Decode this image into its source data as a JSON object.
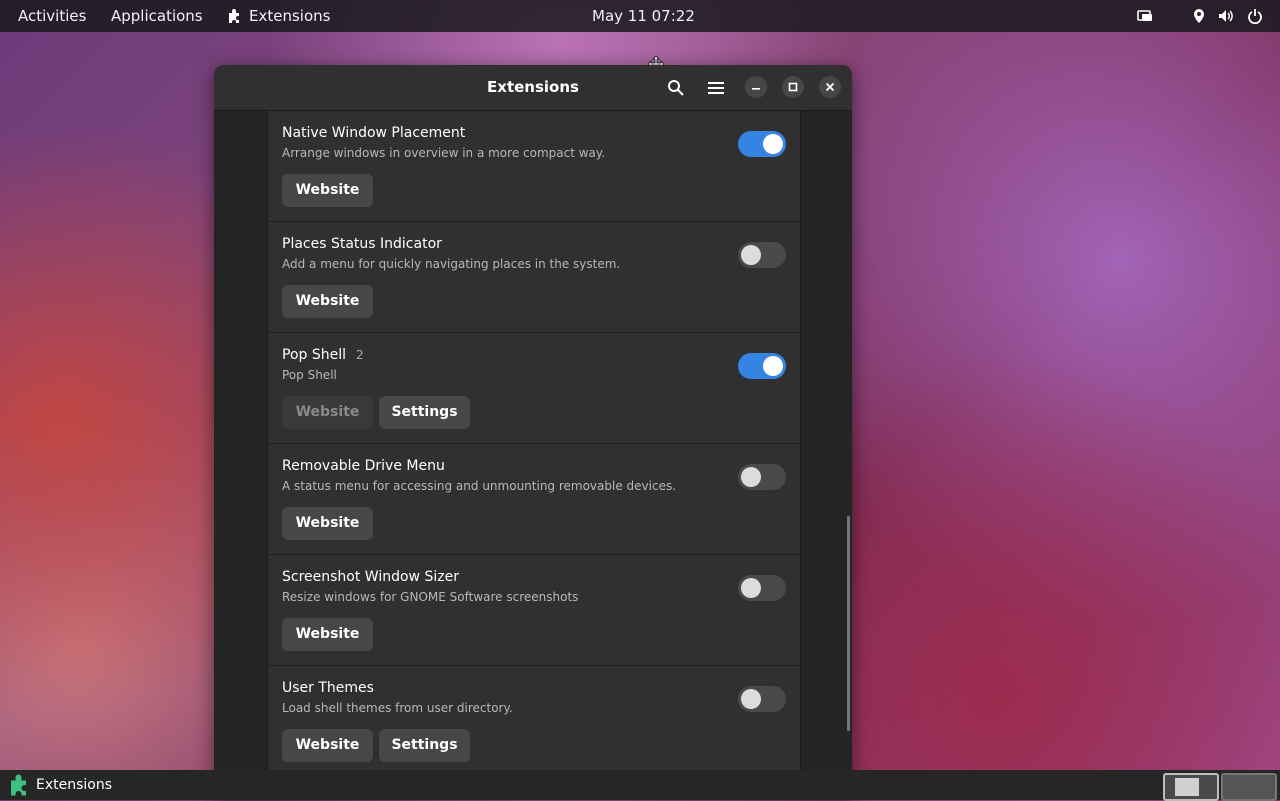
{
  "topbar": {
    "activities": "Activities",
    "applications": "Applications",
    "app_name": "Extensions",
    "clock": "May 11  07:22"
  },
  "window": {
    "title": "Extensions",
    "extensions": [
      {
        "name": "Native Window Placement",
        "count": "",
        "description": "Arrange windows in overview in a more compact way.",
        "enabled": true,
        "website_label": "Website",
        "website_enabled": true,
        "settings_label": ""
      },
      {
        "name": "Places Status Indicator",
        "count": "",
        "description": "Add a menu for quickly navigating places in the system.",
        "enabled": false,
        "website_label": "Website",
        "website_enabled": true,
        "settings_label": ""
      },
      {
        "name": "Pop Shell",
        "count": "2",
        "description": "Pop Shell",
        "enabled": true,
        "website_label": "Website",
        "website_enabled": false,
        "settings_label": "Settings"
      },
      {
        "name": "Removable Drive Menu",
        "count": "",
        "description": "A status menu for accessing and unmounting removable devices.",
        "enabled": false,
        "website_label": "Website",
        "website_enabled": true,
        "settings_label": ""
      },
      {
        "name": "Screenshot Window Sizer",
        "count": "",
        "description": "Resize windows for GNOME Software screenshots",
        "enabled": false,
        "website_label": "Website",
        "website_enabled": true,
        "settings_label": ""
      },
      {
        "name": "User Themes",
        "count": "",
        "description": "Load shell themes from user directory.",
        "enabled": false,
        "website_label": "Website",
        "website_enabled": true,
        "settings_label": "Settings"
      }
    ]
  },
  "taskbar": {
    "app_label": "Extensions"
  },
  "colors": {
    "accent": "#3584e4",
    "puzzle_icon": "#3fbf7f"
  }
}
